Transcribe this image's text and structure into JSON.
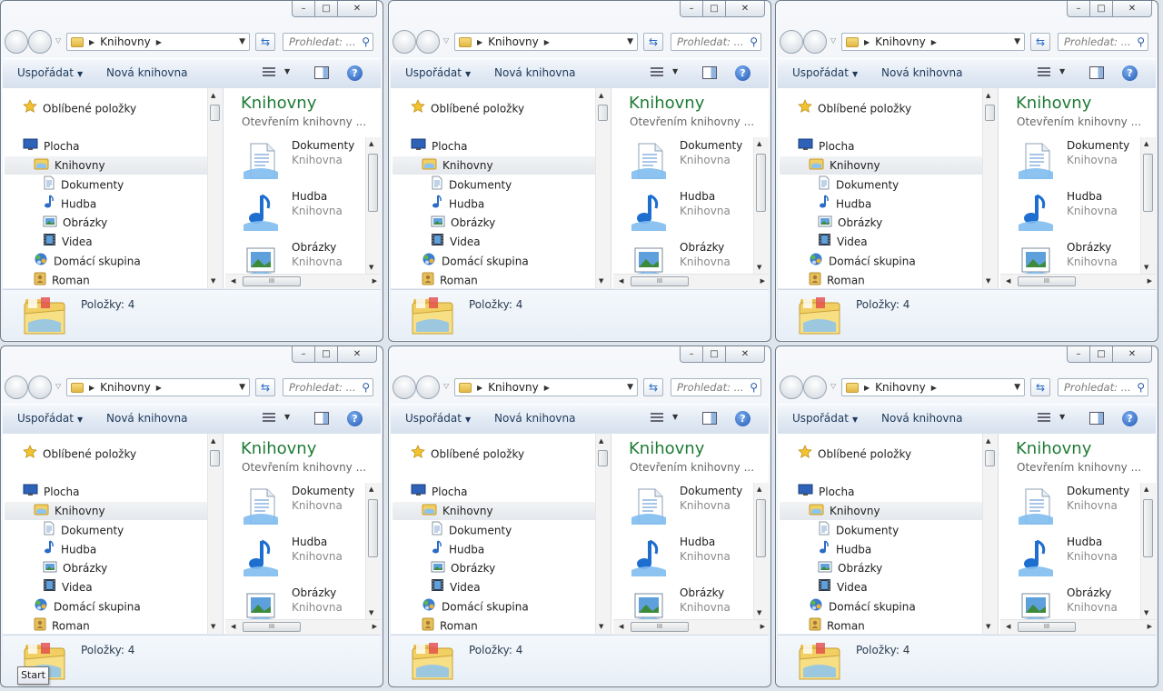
{
  "window": {
    "caption": {
      "minimize": "–",
      "maximize": "□",
      "close": "✕"
    },
    "address": {
      "crumb": "Knihovny",
      "dropdown": "▼"
    },
    "search_placeholder": "Prohledat: ...",
    "toolbar": {
      "organize": "Uspořádat",
      "new_library": "Nová knihovna",
      "help": "?"
    },
    "nav": [
      {
        "label": "Oblíbené položky",
        "icon": "star-icon"
      },
      {
        "label": "Plocha",
        "icon": "desktop-icon"
      },
      {
        "label": "Knihovny",
        "icon": "libraries-folder-icon",
        "selected": true
      },
      {
        "label": "Dokumenty",
        "icon": "documents-icon"
      },
      {
        "label": "Hudba",
        "icon": "music-icon"
      },
      {
        "label": "Obrázky",
        "icon": "pictures-icon"
      },
      {
        "label": "Videa",
        "icon": "videos-icon"
      },
      {
        "label": "Domácí skupina",
        "icon": "homegroup-icon"
      },
      {
        "label": "Roman",
        "icon": "user-folder-icon"
      }
    ],
    "content": {
      "title": "Knihovny",
      "subtitle": "Otevřením knihovny ...",
      "items": [
        {
          "name": "Dokumenty",
          "type": "Knihovna",
          "icon": "documents-library-icon"
        },
        {
          "name": "Hudba",
          "type": "Knihovna",
          "icon": "music-library-icon"
        },
        {
          "name": "Obrázky",
          "type": "Knihovna",
          "icon": "pictures-library-icon"
        }
      ],
      "hscroll_grip": "III"
    },
    "details": {
      "count": "Položky: 4"
    }
  },
  "windows_count": 6,
  "taskbar": {
    "start_tooltip": "Start"
  },
  "colors": {
    "title_green": "#1e7b36",
    "toolbar_text": "#1e395b",
    "selection": "#e5e8ec"
  }
}
